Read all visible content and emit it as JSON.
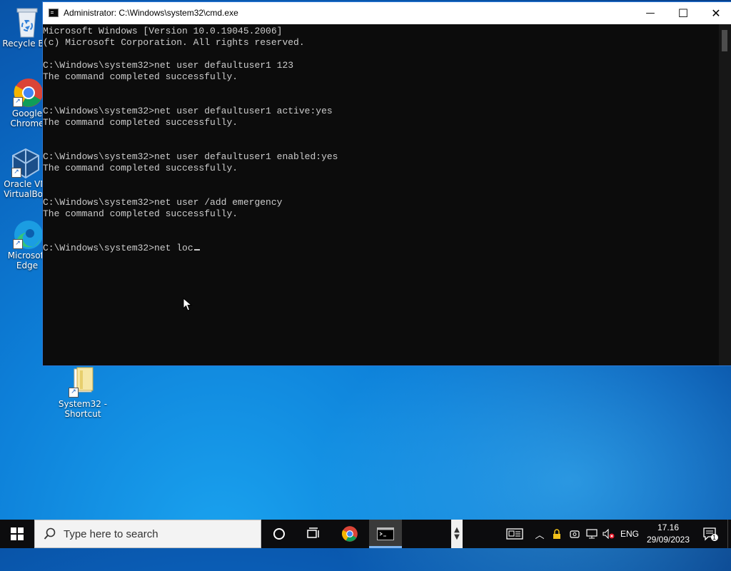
{
  "desktop": {
    "icons": [
      {
        "label_lines": [
          "Recycle Bin"
        ],
        "icon": "recycle-bin-icon"
      },
      {
        "label_lines": [
          "Google",
          "Chrome"
        ],
        "icon": "chrome-icon"
      },
      {
        "label_lines": [
          "Oracle VM",
          "VirtualBox"
        ],
        "icon": "virtualbox-icon"
      },
      {
        "label_lines": [
          "Microsoft",
          "Edge"
        ],
        "icon": "edge-icon"
      },
      {
        "label_lines": [
          "System32 -",
          "Shortcut"
        ],
        "icon": "folder-icon"
      }
    ]
  },
  "window": {
    "title": "Administrator: C:\\Windows\\system32\\cmd.exe",
    "controls": {
      "minimize": "—",
      "maximize": "☐",
      "close": "✕"
    },
    "console_lines": [
      "Microsoft Windows [Version 10.0.19045.2006]",
      "(c) Microsoft Corporation. All rights reserved.",
      "",
      "C:\\Windows\\system32>net user defaultuser1 123",
      "The command completed successfully.",
      "",
      "",
      "C:\\Windows\\system32>net user defaultuser1 active:yes",
      "The command completed successfully.",
      "",
      "",
      "C:\\Windows\\system32>net user defaultuser1 enabled:yes",
      "The command completed successfully.",
      "",
      "",
      "C:\\Windows\\system32>net user /add emergency",
      "The command completed successfully.",
      "",
      ""
    ],
    "prompt_line": "C:\\Windows\\system32>net loc"
  },
  "taskbar": {
    "search_placeholder": "Type here to search",
    "language": "ENG",
    "time": "17.16",
    "date": "29/09/2023",
    "notification_count": "1",
    "accent_color": "#7fb5f0"
  }
}
